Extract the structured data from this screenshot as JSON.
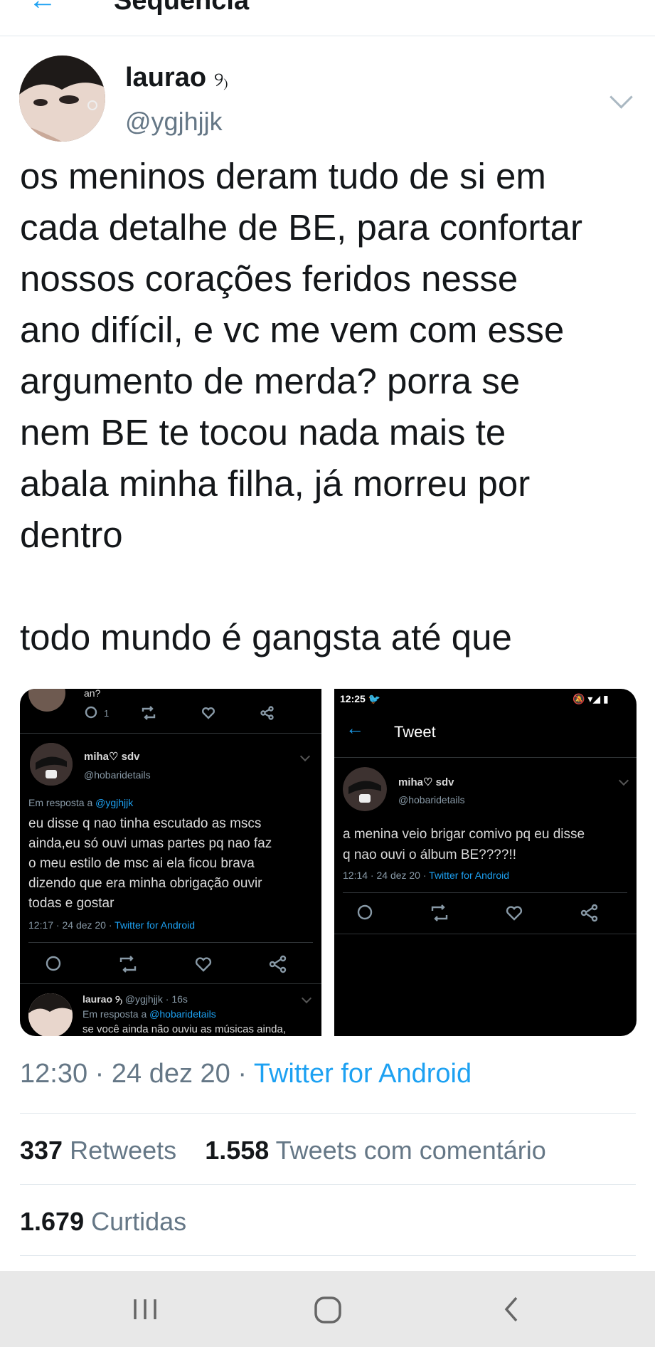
{
  "header": {
    "title": "Sequência"
  },
  "tweet": {
    "name": "laurao",
    "name_emoji": "୨₎",
    "handle": "@ygjhjjk",
    "text": "os meninos deram tudo de si em\ncada detalhe de BE, para confortar\nnossos corações feridos nesse\nano difícil, e vc me vem com esse\nargumento de merda? porra se\nnem BE te tocou nada mais te\nabala minha filha, já morreu por\ndentro\n\ntodo mundo é gangsta até que",
    "time": "12:30 · 24 dez 20 · ",
    "source": "Twitter for Android",
    "retweets_count": "337",
    "retweets_label": "Retweets",
    "comments_count": "1.558",
    "comments_label": "Tweets com comentário",
    "likes_count": "1.679",
    "likes_label": "Curtidas"
  },
  "media1": {
    "top_fragment": "an?",
    "reply_count": "1",
    "name": "miha♡ sdv",
    "handle": "@hobaridetails",
    "reply_to_label": "Em resposta a ",
    "reply_to_handle": "@ygjhjjk",
    "text": "eu disse q nao tinha escutado as mscs\nainda,eu só ouvi umas partes pq nao faz\no meu estilo de msc ai ela ficou brava\ndizendo que era minha obrigação ouvir\ntodas e gostar",
    "time": "12:17 · 24 dez 20 · ",
    "source": "Twitter for Android",
    "reply2_name": "laurao ୨₎",
    "reply2_meta": " @ygjhjjk · 16s",
    "reply2_to_label": "Em resposta a ",
    "reply2_to_handle": "@hobaridetails",
    "reply2_text": "se você ainda não ouviu as músicas ainda,"
  },
  "media2": {
    "status_time": "12:25",
    "title": "Tweet",
    "name": "miha♡ sdv",
    "handle": "@hobaridetails",
    "text": "a menina veio brigar comivo pq eu disse\nq nao ouvi o álbum BE????!!",
    "time": "12:14 · 24 dez 20 · ",
    "source": "Twitter for Android"
  },
  "navbar": {
    "items": [
      "recents-icon",
      "home-icon",
      "back-icon"
    ]
  },
  "colors": {
    "accent": "#1da1f2",
    "muted": "#657786",
    "dark_bg": "#000000"
  }
}
